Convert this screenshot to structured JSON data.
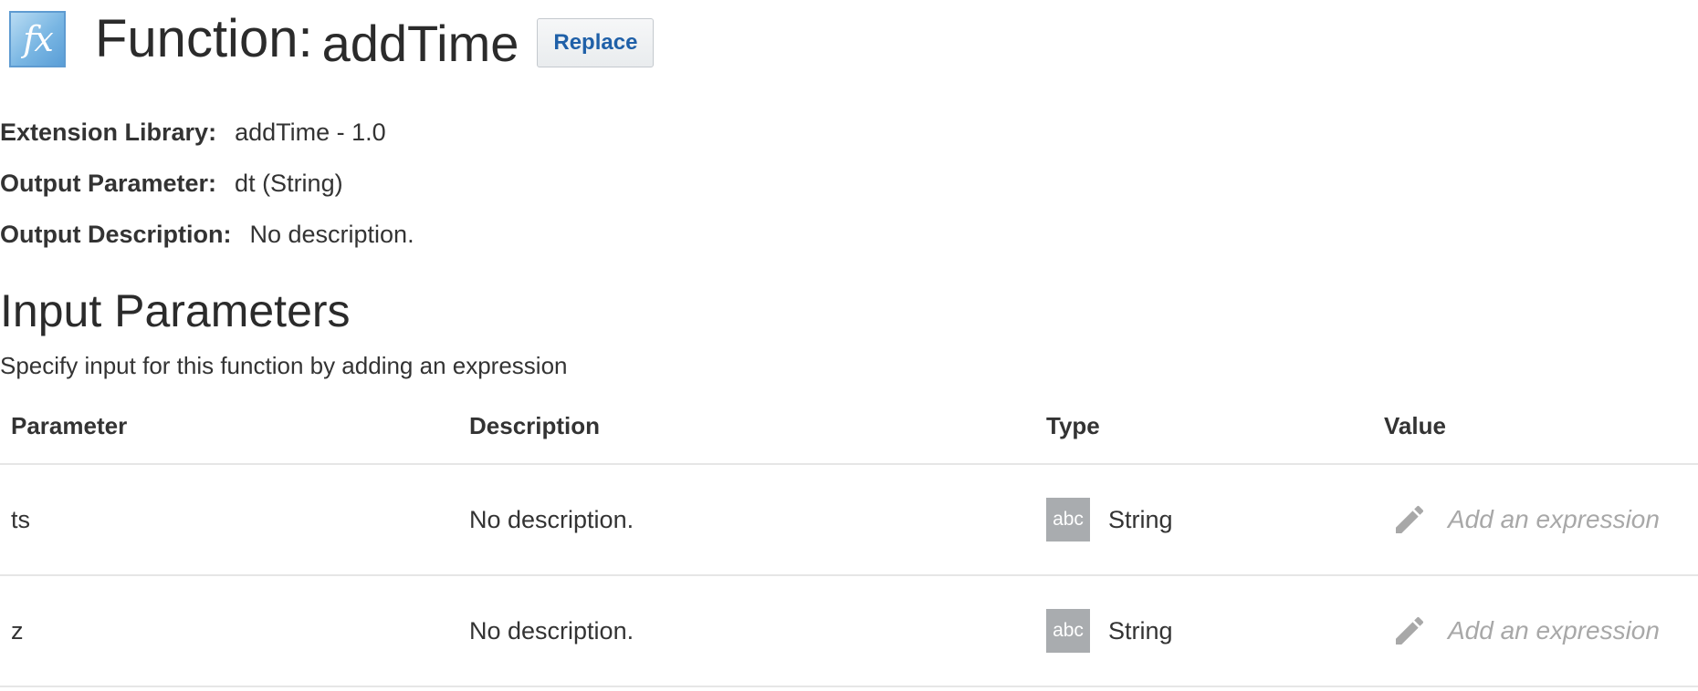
{
  "header": {
    "icon": "function-fx-icon",
    "icon_text": "fx",
    "title_label": "Function:",
    "function_name": "addTime",
    "replace_label": "Replace"
  },
  "info": {
    "library_label": "Extension Library:",
    "library_value": "addTime - 1.0",
    "output_param_label": "Output Parameter:",
    "output_param_value": "dt (String)",
    "output_desc_label": "Output Description:",
    "output_desc_value": "No description."
  },
  "input_section": {
    "title": "Input Parameters",
    "subtitle": "Specify input for this function by adding an expression"
  },
  "table": {
    "columns": [
      "Parameter",
      "Description",
      "Type",
      "Value"
    ],
    "rows": [
      {
        "parameter": "ts",
        "description": "No description.",
        "type_badge": "abc",
        "type": "String",
        "value": "Add an expression"
      },
      {
        "parameter": "z",
        "description": "No description.",
        "type_badge": "abc",
        "type": "String",
        "value": "Add an expression"
      }
    ]
  },
  "colors": {
    "button_text": "#1f60a8",
    "placeholder": "#a8a8a8",
    "type_badge": "#a9acaf",
    "icon_blue": "#79b6e3"
  }
}
